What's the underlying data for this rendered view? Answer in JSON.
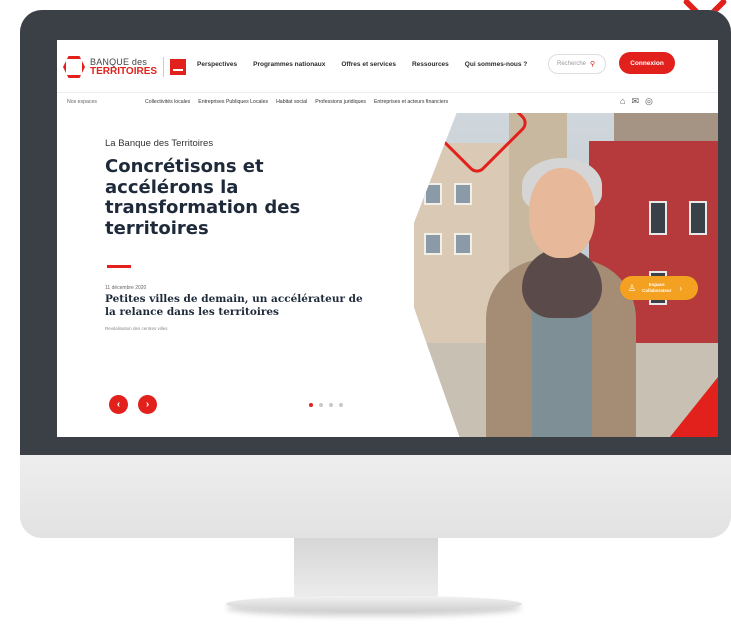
{
  "header": {
    "logo_line1": "BANQUE des",
    "logo_line2": "TERRITOIRES",
    "nav": [
      "Perspectives",
      "Programmes nationaux",
      "Offres et services",
      "Ressources",
      "Qui sommes-nous ?"
    ],
    "search_placeholder": "Recherche",
    "login_label": "Connexion"
  },
  "subnav": {
    "title": "Nos espaces",
    "items": [
      "Collectivités locales",
      "Entreprises Publiques Locales",
      "Habitat social",
      "Professions juridiques",
      "Entreprises et acteurs financiers"
    ],
    "icons": [
      "home-icon",
      "mail-icon",
      "accessibility-icon"
    ]
  },
  "hero": {
    "kicker": "La Banque des Territoires",
    "title": "Concrétisons et accélérons la transformation des territoires",
    "news_date": "11 décembre 2020",
    "news_title": "Petites villes de demain, un accélérateur de la relance dans les territoires",
    "news_tag": "Revitalisation des centres villes",
    "prev_symbol": "‹",
    "next_symbol": "›",
    "slide_count": 4,
    "active_slide": 1
  },
  "collab": {
    "line1": "Espace",
    "line2": "Collaborateur"
  },
  "colors": {
    "brand_red": "#e2211c",
    "collab_orange": "#f4a020",
    "bezel": "#3b3f46"
  }
}
